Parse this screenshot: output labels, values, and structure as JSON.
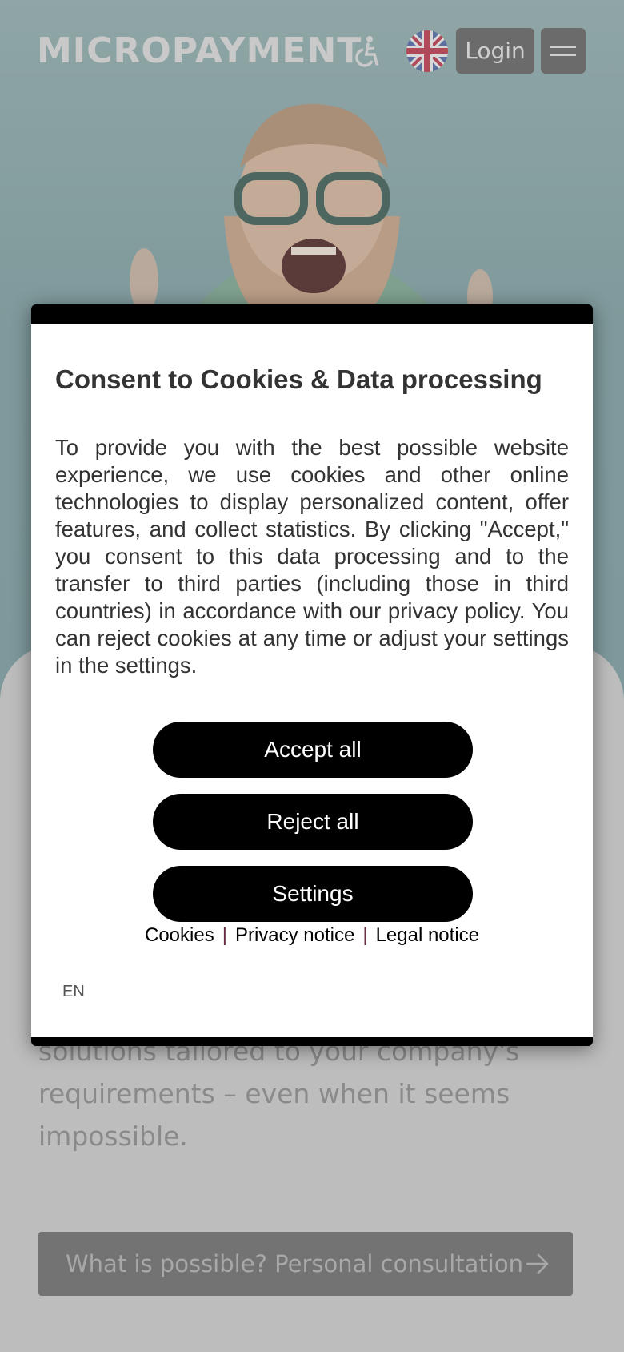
{
  "header": {
    "logo": "MICROPAYMENT",
    "accessibility_icon": "accessibility-icon",
    "language_flag_icon": "uk-flag-icon",
    "login_label": "Login",
    "menu_icon": "hamburger-menu-icon"
  },
  "main": {
    "body_text": "solutions tailored to your company's requirements – even when it seems impossible.",
    "cta_label": "What is possible? Personal consultation",
    "cta_icon": "arrow-right-icon"
  },
  "cookie_modal": {
    "title": "Consent to Cookies & Data processing",
    "text": "To provide you with the best possible website experience, we use cookies and other online technologies to display personalized content, offer features, and collect statistics. By clicking \"Accept,\" you consent to this data processing and to the transfer to third parties (including those in third countries) in accordance with our privacy policy. You can reject cookies at any time or adjust your settings in the settings.",
    "accept_label": "Accept all",
    "reject_label": "Reject all",
    "settings_label": "Settings",
    "links": {
      "cookies": "Cookies",
      "separator": "|",
      "privacy": "Privacy notice",
      "legal": "Legal notice"
    },
    "language": "EN"
  },
  "colors": {
    "modal_button_bg": "#000000",
    "link_separator": "#6b2b45",
    "overlay_hero": "#7f9a9c",
    "overlay_panel": "#bdbdbd"
  }
}
